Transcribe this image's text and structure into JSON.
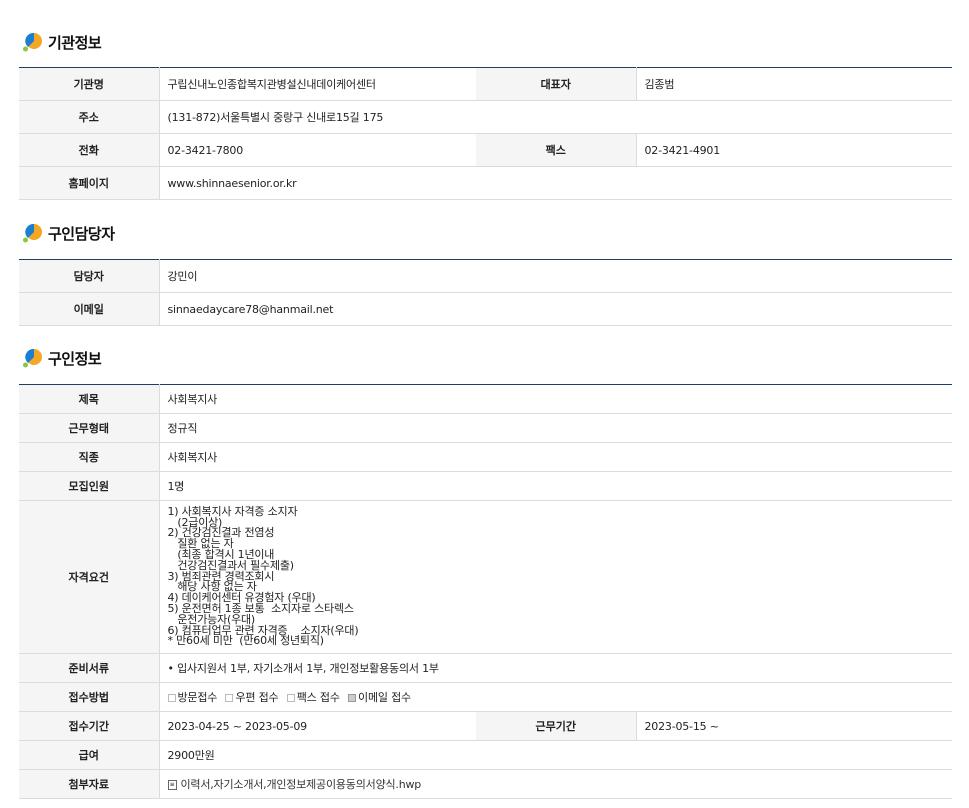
{
  "sections": {
    "org": {
      "title": "기관정보"
    },
    "contact": {
      "title": "구인담당자"
    },
    "job": {
      "title": "구인정보"
    }
  },
  "org": {
    "name_label": "기관명",
    "name": "구립신내노인종합복지관병설신내데이케어센터",
    "rep_label": "대표자",
    "rep": "김종범",
    "addr_label": "주소",
    "addr": "(131-872)서울특별시 중랑구 신내로15길 175",
    "tel_label": "전화",
    "tel": "02-3421-7800",
    "fax_label": "팩스",
    "fax": "02-3421-4901",
    "web_label": "홈페이지",
    "web": "www.shinnaesenior.or.kr"
  },
  "contact": {
    "manager_label": "담당자",
    "manager": "강민이",
    "email_label": "이메일",
    "email": "sinnaedaycare78@hanmail.net"
  },
  "job": {
    "title_label": "제목",
    "title": "사회복지사",
    "type_label": "근무형태",
    "type": "정규직",
    "occupation_label": "직종",
    "occupation": "사회복지사",
    "headcount_label": "모집인원",
    "headcount": "1명",
    "qual_label": "자격요건",
    "qual": "1) 사회복지사 자격증 소지자\n   (2급이상)\n2) 건강검진결과 전염성\n   질환 없는 자\n   (최종 합격시 1년이내\n   건강검진결과서 필수제출)\n3) 범죄관련 경력조회시\n   해당 사항 없는 자\n4) 데이케어센터 유경험자 (우대)\n5) 운전면허 1종 보통  소지자로 스타렉스\n   운전가능자(우대)\n6) 컴퓨터업무 관련 자격증    소지자(우대)\n* 만60세 미만  (만60세 정년퇴직)",
    "docs_label": "준비서류",
    "docs": "• 입사지원서 1부, 자기소개서 1부, 개인정보활용동의서 1부",
    "method_label": "접수방법",
    "methods": [
      "방문접수",
      "우편 접수",
      "팩스 접수",
      "이메일 접수"
    ],
    "period_label": "접수기간",
    "period": "2023-04-25 ~ 2023-05-09",
    "work_label": "근무기간",
    "work": "2023-05-15 ~",
    "salary_label": "급여",
    "salary": "2900만원",
    "attach_label": "첨부자료",
    "attach": "이력서,자기소개서,개인정보제공이용동의서양식.hwp"
  },
  "colors": {
    "table_border": "#1f3f63",
    "header_bg": "#f5f5f5",
    "icon_blue": "#1a7fd0",
    "icon_orange": "#f5a623",
    "icon_green": "#8cc63f"
  }
}
